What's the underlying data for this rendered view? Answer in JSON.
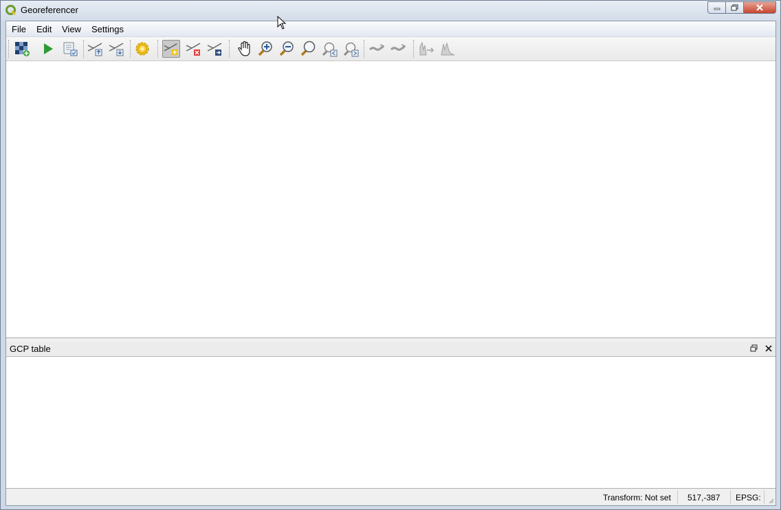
{
  "window": {
    "title": "Georeferencer"
  },
  "menu": {
    "items": [
      "File",
      "Edit",
      "View",
      "Settings"
    ]
  },
  "toolbar": {
    "buttons": [
      {
        "name": "open-raster-button",
        "icon": "open-raster-icon"
      },
      {
        "name": "start-georeferencing-button",
        "icon": "play-icon"
      },
      {
        "name": "generate-gdal-script-button",
        "icon": "gdal-script-icon"
      },
      {
        "name": "load-gcp-points-button",
        "icon": "load-gcp-icon"
      },
      {
        "name": "save-gcp-points-button",
        "icon": "save-gcp-icon"
      },
      {
        "name": "transformation-settings-button",
        "icon": "gear-icon"
      },
      {
        "name": "add-point-button",
        "icon": "add-point-icon",
        "active": true
      },
      {
        "name": "delete-point-button",
        "icon": "delete-point-icon"
      },
      {
        "name": "move-gcp-point-button",
        "icon": "move-point-icon"
      },
      {
        "name": "pan-button",
        "icon": "hand-icon"
      },
      {
        "name": "zoom-in-button",
        "icon": "zoom-in-icon"
      },
      {
        "name": "zoom-out-button",
        "icon": "zoom-out-icon"
      },
      {
        "name": "zoom-to-layer-button",
        "icon": "zoom-layer-icon"
      },
      {
        "name": "zoom-last-button",
        "icon": "zoom-last-icon"
      },
      {
        "name": "zoom-next-button",
        "icon": "zoom-next-icon"
      },
      {
        "name": "link-georeferencer-to-qgis-button",
        "icon": "link-geo-icon"
      },
      {
        "name": "link-qgis-to-georeferencer-button",
        "icon": "link-qgis-icon"
      },
      {
        "name": "full-histogram-stretch-button",
        "icon": "histogram-stretch-icon"
      },
      {
        "name": "local-histogram-stretch-button",
        "icon": "histogram-local-icon"
      }
    ]
  },
  "dock": {
    "title": "GCP table"
  },
  "status": {
    "transform": "Transform: Not set",
    "coords": "517,-387",
    "epsg": "EPSG:"
  },
  "colors": {
    "accent": "#6a9b2e",
    "close": "#c8452f"
  }
}
